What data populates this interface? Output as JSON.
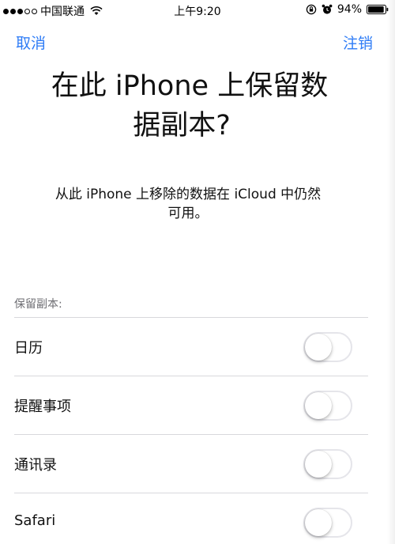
{
  "status_bar": {
    "carrier": "中国联通",
    "signal_dots_full": 3,
    "signal_dots_total": 5,
    "time": "上午9:20",
    "battery": "94%",
    "battery_level": 0.94
  },
  "nav": {
    "cancel_label": "取消",
    "logout_label": "注销",
    "accent_color": "#2e7cf6"
  },
  "title_line1": "在此 iPhone 上保留数",
  "title_line2": "据副本?",
  "subtitle_line1": "从此 iPhone 上移除的数据在 iCloud 中仍然",
  "subtitle_line2": "可用。",
  "section_header": "保留副本:",
  "items": [
    {
      "label": "日历",
      "enabled": false
    },
    {
      "label": "提醒事项",
      "enabled": false
    },
    {
      "label": "通讯录",
      "enabled": false
    },
    {
      "label": "Safari",
      "enabled": false
    }
  ]
}
